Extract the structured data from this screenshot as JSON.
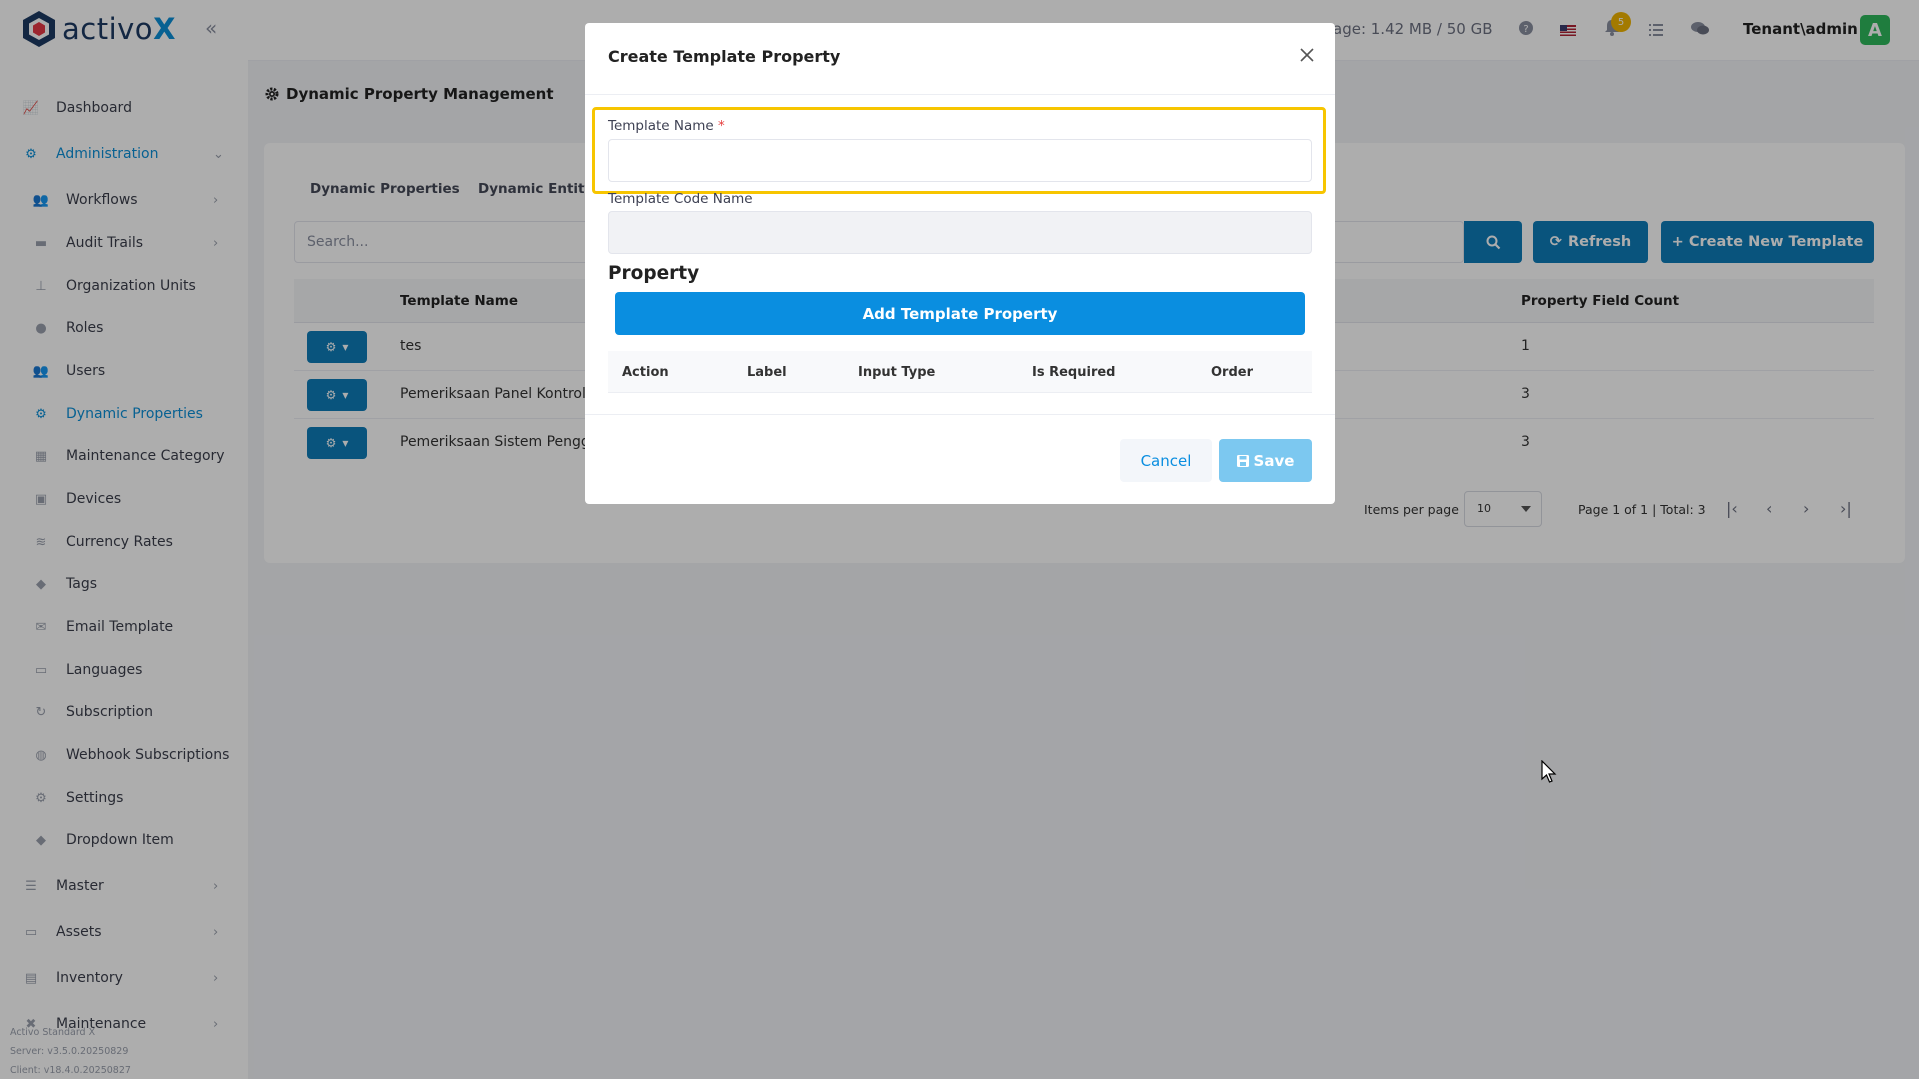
{
  "app": {
    "logo_prefix": "activo",
    "logo_suffix": "X",
    "collapse_icon": "double-chevron-left-icon"
  },
  "sidebar": {
    "items": [
      {
        "label": "Dashboard",
        "icon": "chart-line-icon"
      },
      {
        "label": "Administration",
        "icon": "cogs-icon",
        "active": true,
        "expanded": true
      },
      {
        "label": "Workflows",
        "icon": "users-group-icon",
        "has_children": true
      },
      {
        "label": "Audit Trails",
        "icon": "folder-icon",
        "has_children": true
      },
      {
        "label": "Organization Units",
        "icon": "sitemap-icon"
      },
      {
        "label": "Roles",
        "icon": "user-icon"
      },
      {
        "label": "Users",
        "icon": "users-icon"
      },
      {
        "label": "Dynamic Properties",
        "icon": "gear-icon",
        "active": true
      },
      {
        "label": "Maintenance Category",
        "icon": "grid-icon"
      },
      {
        "label": "Devices",
        "icon": "print-icon"
      },
      {
        "label": "Currency Rates",
        "icon": "coins-icon"
      },
      {
        "label": "Tags",
        "icon": "tags-icon"
      },
      {
        "label": "Email Template",
        "icon": "envelope-icon"
      },
      {
        "label": "Languages",
        "icon": "language-icon"
      },
      {
        "label": "Subscription",
        "icon": "refresh-icon"
      },
      {
        "label": "Webhook Subscriptions",
        "icon": "globe-icon"
      },
      {
        "label": "Settings",
        "icon": "gear-icon"
      },
      {
        "label": "Dropdown Item",
        "icon": "tags-icon"
      },
      {
        "label": "Master",
        "icon": "database-icon",
        "has_children": true
      },
      {
        "label": "Assets",
        "icon": "laptop-icon",
        "has_children": true
      },
      {
        "label": "Inventory",
        "icon": "inbox-icon",
        "has_children": true
      },
      {
        "label": "Maintenance",
        "icon": "tools-icon",
        "has_children": true
      }
    ],
    "footer": {
      "edition": "Activo Standard X",
      "server": "Server: v3.5.0.20250829",
      "client": "Client: v18.4.0.20250827"
    }
  },
  "topbar": {
    "storage_text": "age: 1.42 MB / 50 GB",
    "notification_count": "5",
    "user": "Tenant\\admin",
    "avatar_letter": "A",
    "icons": [
      "question-circle-icon",
      "us-flag-icon",
      "bell-icon",
      "list-icon",
      "chat-icon"
    ]
  },
  "page": {
    "title": "Dynamic Property Management",
    "tabs": [
      "Dynamic Properties",
      "Dynamic Entity"
    ],
    "search_placeholder": "Search...",
    "refresh_label": "Refresh",
    "create_label": "+ Create New Template",
    "table": {
      "headers": [
        "Template Name",
        "Property Field Count"
      ],
      "rows": [
        {
          "name": "tes",
          "count": "1"
        },
        {
          "name": "Pemeriksaan Panel Kontrol &",
          "count": "3"
        },
        {
          "name": "Pemeriksaan Sistem Pengge",
          "count": "3"
        }
      ]
    },
    "pager": {
      "items_per_page_label": "Items per page",
      "items_per_page_value": "10",
      "summary": "Page 1 of 1 | Total: 3"
    }
  },
  "modal": {
    "title": "Create Template Property",
    "template_name_label": "Template Name",
    "required_mark": "*",
    "template_name_value": "",
    "template_code_label": "Template Code Name",
    "template_code_value": "",
    "section_title": "Property",
    "add_button": "Add Template Property",
    "columns": [
      "Action",
      "Label",
      "Input Type",
      "Is Required",
      "Order"
    ],
    "cancel_label": "Cancel",
    "save_label": "Save"
  },
  "colors": {
    "primary": "#0e7cb8",
    "accent": "#0a8ee0",
    "highlight": "#f7c500",
    "avatar": "#2eb85c",
    "badge": "#f0b400"
  }
}
